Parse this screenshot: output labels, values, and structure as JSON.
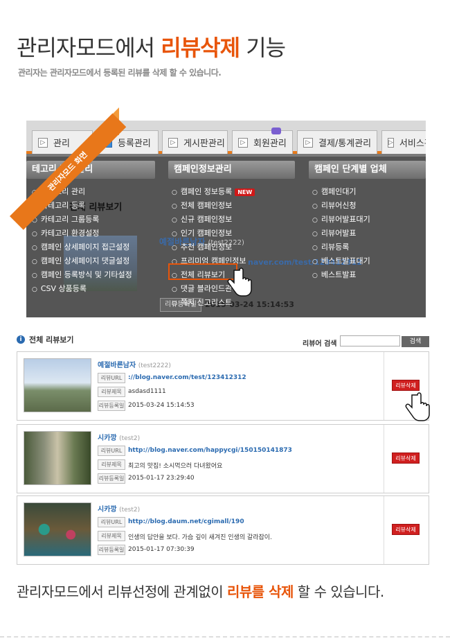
{
  "header": {
    "title_pre": "관리자모드에서 ",
    "title_hl": "리뷰삭제",
    "title_post": " 기능",
    "subtitle": "관리자는 관리자모드에서 등록된 리뷰를 삭제 할 수 있습니다."
  },
  "screenshot": {
    "ribbon": "관리자모드 화면",
    "tabs": [
      {
        "label": "관리"
      },
      {
        "label": "등록관리"
      },
      {
        "label": "게시판관리"
      },
      {
        "label": "회원관리"
      },
      {
        "label": "결제/통계관리"
      },
      {
        "label": "서비스관"
      }
    ],
    "menus": [
      {
        "title": "테고리 정보관리",
        "items": [
          "카테고리 관리",
          "카테고리 등록",
          "카테고리 그룹등록",
          "카테고리 환경설정",
          "캠페인 상세페이지 접근설정",
          "캠페인 상세페이지 댓글설정",
          "캠페인 등록방식 및 기타설정",
          "CSV 상품등록"
        ]
      },
      {
        "title": "캠페인정보관리",
        "items": [
          "캠페인 정보등록",
          "전체 캠페인정보",
          "신규 캠페인정보",
          "인기 캠페인정보",
          "추천 캠페인정보",
          "프리미엄 캠페인정보",
          "전체 리뷰보기",
          "댓글 블라인드관리",
          "쪽지 신고리스트"
        ],
        "new_badge": "NEW"
      },
      {
        "title": "캠페인 단계별 업체",
        "items": [
          "캠페인대기",
          "리뷰어신청",
          "리뷰어발표대기",
          "리뷰어발표",
          "리뷰등록",
          "베스트발표대기",
          "베스트발표"
        ]
      }
    ],
    "bg": {
      "breadcrumb": "HOME > 등록관리 > 전체 리뷰보기",
      "section": "전체 리뷰보기",
      "nick": "예절바른남자",
      "uid": "(test2222)",
      "url": "naver.com/test/123412312",
      "date_label": "리뷰등록일",
      "date": "2015-03-24 15:14:53"
    }
  },
  "list": {
    "title": "전체 리뷰보기",
    "search_label": "리뷰어 검색",
    "search_btn": "검색",
    "url_label": "리뷰URL",
    "title_label": "리뷰제목",
    "date_label": "리뷰등록일",
    "delete_label": "리뷰삭제",
    "reviews": [
      {
        "nick": "예절바른남자",
        "uid": "(test2222)",
        "url": "://blog.naver.com/test/123412312",
        "title": "asdasd1111",
        "date": "2015-03-24 15:14:53"
      },
      {
        "nick": "시카깡",
        "uid": "(test2)",
        "url": "http://blog.naver.com/happycgi/150150141873",
        "title": "최고의 맛집! 소시먹으러 다녀왔어요",
        "date": "2015-01-17 23:29:40"
      },
      {
        "nick": "시카깡",
        "uid": "(test2)",
        "url": "http://blog.daum.net/cgimall/190",
        "title": "인생의 답안을 보다. 가슴 깊이 새겨진 인생의 갈라잡이.",
        "date": "2015-01-17 07:30:39"
      }
    ]
  },
  "footer": {
    "pre": "관리자모드에서 리뷰선정에 관계없이 ",
    "hl": "리뷰를 삭제",
    "post": " 할 수 있습니다."
  },
  "colors": {
    "accent": "#e8550a",
    "delete": "#d02020",
    "link": "#2a6ab0"
  }
}
